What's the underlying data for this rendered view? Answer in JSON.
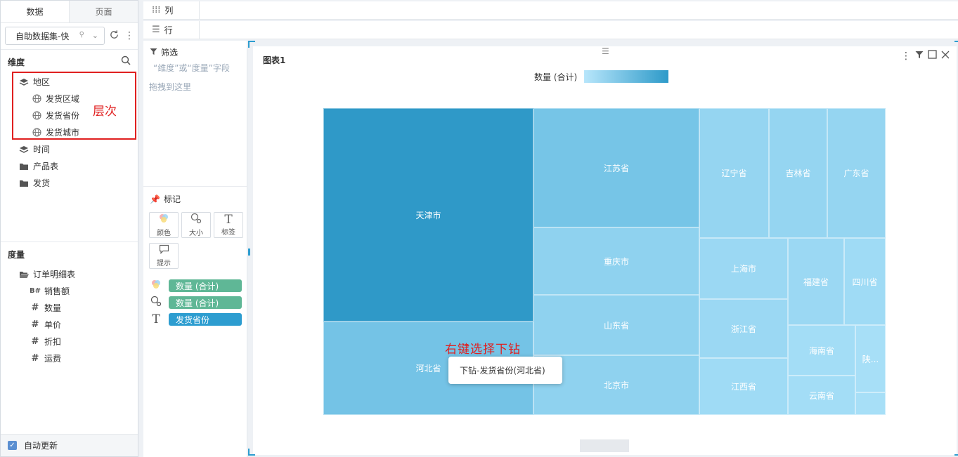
{
  "left_panel": {
    "tabs": [
      "数据",
      "页面"
    ],
    "dataset_select": "自助数据集-快",
    "dimensions_title": "维度",
    "dimensions": [
      {
        "label": "地区",
        "icon": "layers-icon"
      },
      {
        "label": "发货区域",
        "icon": "globe-icon"
      },
      {
        "label": "发货省份",
        "icon": "globe-icon"
      },
      {
        "label": "发货城市",
        "icon": "globe-icon"
      },
      {
        "label": "时间",
        "icon": "layers-icon"
      },
      {
        "label": "产品表",
        "icon": "folder-icon"
      },
      {
        "label": "发货",
        "icon": "folder-icon"
      }
    ],
    "hierarchy_note": "层次",
    "measures_title": "度量",
    "measures": [
      {
        "label": "订单明细表",
        "icon": "folder-open-icon"
      },
      {
        "label": "销售额",
        "icon": "calc-field-icon",
        "glyph": "B#"
      },
      {
        "label": "数量",
        "icon": "hash-icon",
        "glyph": "#"
      },
      {
        "label": "单价",
        "icon": "hash-icon",
        "glyph": "#"
      },
      {
        "label": "折扣",
        "icon": "hash-icon",
        "glyph": "#"
      },
      {
        "label": "运费",
        "icon": "hash-icon",
        "glyph": "#"
      }
    ],
    "auto_update": "自动更新"
  },
  "shelves": {
    "columns_label": "列",
    "rows_label": "行"
  },
  "mid_panel": {
    "filter_title": "筛选",
    "filter_hint_1": "“维度”或“度量”字段",
    "filter_hint_2": "拖拽到这里",
    "marks_title": "标记",
    "mark_buttons": [
      "颜色",
      "大小",
      "标签",
      "提示"
    ],
    "pills": [
      {
        "label": "数量 (合计)",
        "icon": "color-icon",
        "color": "#5fb796"
      },
      {
        "label": "数量 (合计)",
        "icon": "size-icon",
        "color": "#5fb796"
      },
      {
        "label": "发货省份",
        "icon": "label-icon",
        "color": "#2d9dd0"
      }
    ]
  },
  "chart": {
    "title": "图表1",
    "legend_label": "数量 (合计)",
    "legend_colors": [
      "#b8e6fb",
      "#2d9ac9"
    ],
    "drill_note": "右键选择下钻",
    "context_menu_item": "下钻-发货省份(河北省)"
  },
  "chart_data": {
    "type": "treemap",
    "measure": "数量 (合计)",
    "cells": [
      {
        "label": "天津市",
        "color": "#2f99c8"
      },
      {
        "label": "河北省",
        "color": "#74c3e6"
      },
      {
        "label": "江苏省",
        "color": "#76c5e7"
      },
      {
        "label": "重庆市",
        "color": "#8fd2ef"
      },
      {
        "label": "山东省",
        "color": "#8fd2ef"
      },
      {
        "label": "北京市",
        "color": "#8fd2ef"
      },
      {
        "label": "辽宁省",
        "color": "#95d5f1"
      },
      {
        "label": "吉林省",
        "color": "#95d5f1"
      },
      {
        "label": "广东省",
        "color": "#95d5f1"
      },
      {
        "label": "上海市",
        "color": "#9bd8f3"
      },
      {
        "label": "浙江省",
        "color": "#9bd8f3"
      },
      {
        "label": "江西省",
        "color": "#9fdbf5"
      },
      {
        "label": "福建省",
        "color": "#9bd8f3"
      },
      {
        "label": "四川省",
        "color": "#9fdbf5"
      },
      {
        "label": "海南省",
        "color": "#a3ddf6"
      },
      {
        "label": "云南省",
        "color": "#a3ddf6"
      },
      {
        "label": "陕...",
        "color": "#a7dff7"
      },
      {
        "label": "",
        "color": "#a7dff7"
      }
    ]
  }
}
